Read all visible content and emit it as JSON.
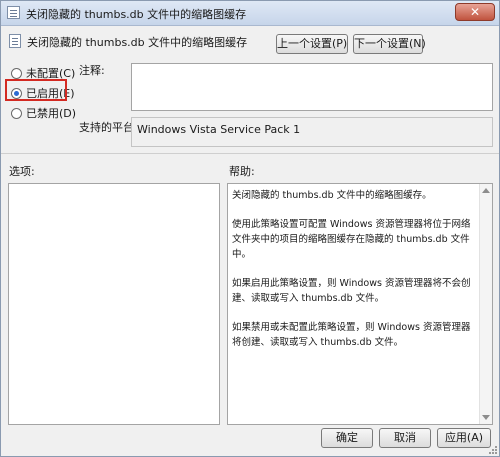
{
  "window": {
    "title": "关闭隐藏的 thumbs.db 文件中的缩略图缓存",
    "close_glyph": "✕"
  },
  "header": {
    "policy_name": "关闭隐藏的 thumbs.db 文件中的缩略图缓存",
    "prev_label": "上一个设置(P)",
    "next_label": "下一个设置(N)"
  },
  "state_options": [
    {
      "label": "未配置(C)",
      "checked": false
    },
    {
      "label": "已启用(E)",
      "checked": true
    },
    {
      "label": "已禁用(D)",
      "checked": false
    }
  ],
  "comment": {
    "label": "注释:",
    "value": ""
  },
  "platform": {
    "label": "支持的平台:",
    "value": "Windows Vista Service Pack 1"
  },
  "options_section": {
    "label": "选项:"
  },
  "help_section": {
    "label": "帮助:",
    "paragraphs": [
      "关闭隐藏的 thumbs.db 文件中的缩略图缓存。",
      "使用此策略设置可配置 Windows 资源管理器将位于网络文件夹中的项目的缩略图缓存在隐藏的 thumbs.db 文件中。",
      "如果启用此策略设置，则 Windows 资源管理器将不会创建、读取或写入 thumbs.db 文件。",
      "如果禁用或未配置此策略设置，则 Windows 资源管理器将创建、读取或写入 thumbs.db 文件。"
    ]
  },
  "footer": {
    "ok_label": "确定",
    "cancel_label": "取消",
    "apply_label": "应用(A)"
  },
  "colors": {
    "highlight": "#d32a22",
    "close_button": "#c0533e"
  }
}
